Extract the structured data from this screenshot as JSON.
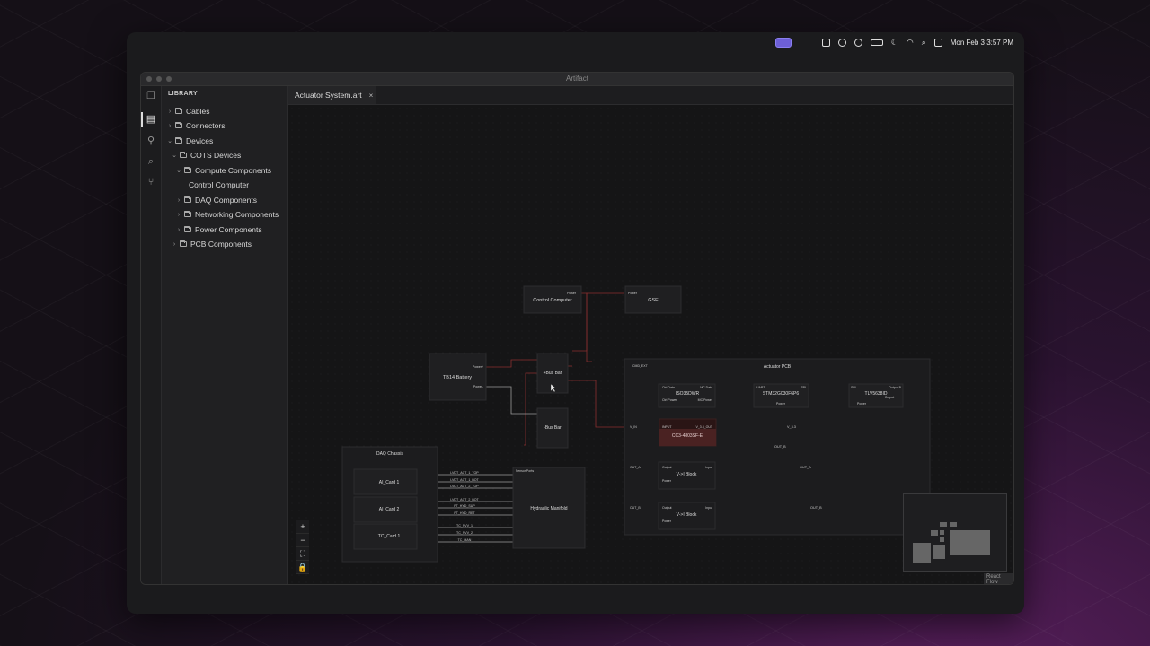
{
  "menubar": {
    "datetime": "Mon Feb 3  3:57 PM",
    "icons": [
      "apple-icon",
      "screen-share-icon",
      "notes-icon",
      "globe-icon",
      "play-icon",
      "battery-icon",
      "moon-icon",
      "wifi-icon",
      "search-icon",
      "control-center-icon"
    ]
  },
  "window": {
    "title": "Artifact"
  },
  "sidebar": {
    "title": "LIBRARY",
    "items": [
      {
        "label": "Cables"
      },
      {
        "label": "Connectors"
      },
      {
        "label": "Devices"
      },
      {
        "label": "COTS Devices"
      },
      {
        "label": "Compute Components"
      },
      {
        "label": "Control Computer"
      },
      {
        "label": "DAQ Components"
      },
      {
        "label": "Networking Components"
      },
      {
        "label": "Power Components"
      },
      {
        "label": "PCB Components"
      }
    ]
  },
  "tab": {
    "label": "Actuator System.art",
    "close": "×"
  },
  "diagram": {
    "nodes": {
      "control_computer": "Control Computer",
      "gse": "GSE",
      "battery": "TB14 Battery",
      "pos_bus": "+Bus Bar",
      "neg_bus": "-Bus Bar",
      "daq_chassis": "DAQ Chassis",
      "ai_card1": "AI_Card 1",
      "ai_card2": "AI_Card 2",
      "tc_card1": "TC_Card 1",
      "manifold": "Hydraulic Manifold",
      "actuator_pcb": "Actuator PCB",
      "iso": "ISO35DWR",
      "stm": "STM32G030F6P6",
      "tlv": "TLV5638ID",
      "cc3": "CC3-4803SF-E",
      "vi_block1": "V->I Block",
      "vi_block2": "V->I Block"
    },
    "ports": {
      "power": "Power",
      "power_pos": "Power+",
      "power_neg": "Power-",
      "cmd_ext": "CMD_EXT",
      "ctrl_data": "Ctrl Data",
      "ctrl_power": "Ctrl Power",
      "mc_data": "MC Data",
      "mc_power": "MC Power",
      "uart": "UART",
      "spi": "SPI",
      "output_b": "Output B",
      "output": "Output",
      "input_upper": "INPUT",
      "input": "Input",
      "v_in": "V_IN",
      "v33_out": "V_3.3_OUT",
      "out_a_port": "OUT_A",
      "out_b_port": "OUT_B",
      "sensor_port": "Sensor Ports"
    },
    "nets": {
      "v33": "V_3.3",
      "out_b": "OUT_B",
      "out_a": "OUT_A",
      "sensor": [
        "LVDT_ACT_1_TOP",
        "LVDT_ACT_1_BOT",
        "LVDT_ACT_2_TOP",
        "LVDT_ACT_2_BOT",
        "PT_HYD_SUP",
        "PT_HYD_RET",
        "TC_SVV_1",
        "TC_SVV_2",
        "TC_MAN"
      ]
    }
  },
  "controls": {
    "zoom_in": "+",
    "zoom_out": "−",
    "fit": "⛶",
    "lock": "🔒"
  },
  "attribution": "React Flow",
  "colors": {
    "accent": "#6d5fd6",
    "wire_power": "#8a2f2f",
    "wire_signal": "#3a35a8",
    "wire_data": "#9a9a9a"
  }
}
